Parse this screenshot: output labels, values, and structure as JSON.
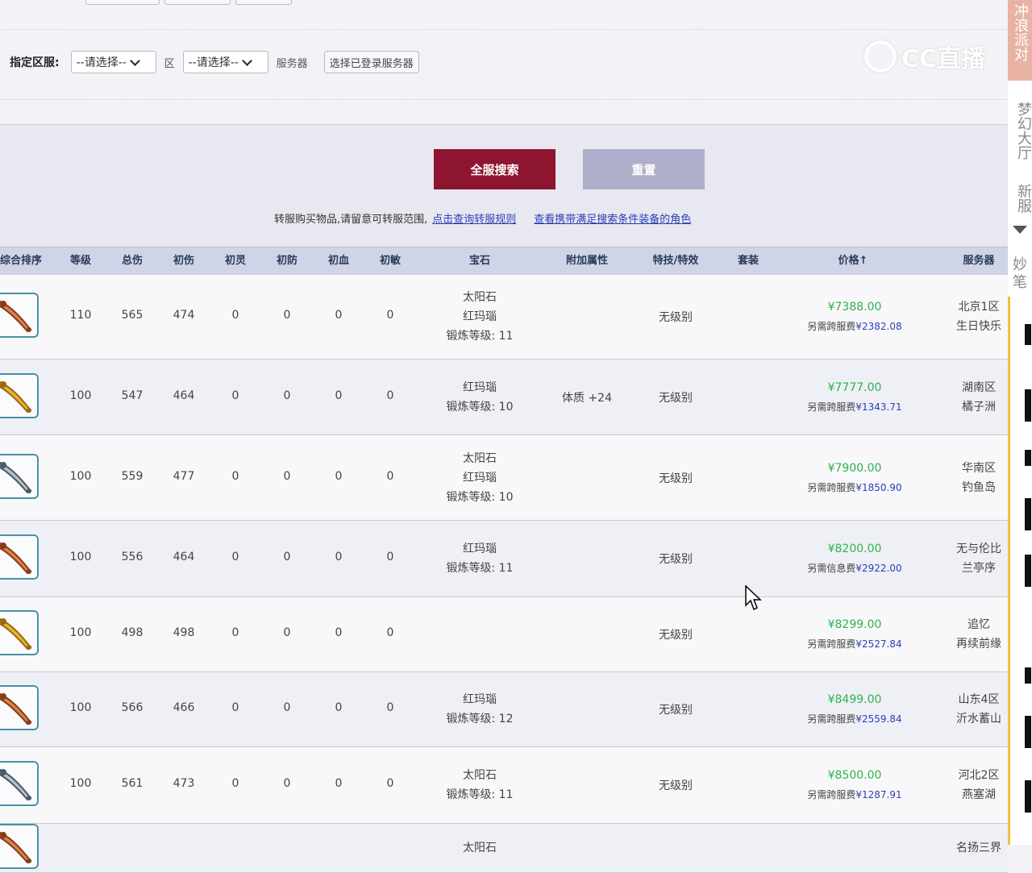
{
  "filter": {
    "label": "指定区服:",
    "region_select": "--请选择--",
    "region_suffix": "区",
    "server_select": "--请选择--",
    "server_suffix": "服务器",
    "logged_server_button": "选择已登录服务器"
  },
  "actions": {
    "search_all": "全服搜索",
    "reset": "重置"
  },
  "notice": {
    "text": "转服购买物品,请留意可转服范围,",
    "link1": "点击查询转服规则",
    "link2": "查看携带满足搜索条件装备的角色"
  },
  "table": {
    "headers": [
      "综合排序",
      "等级",
      "总伤",
      "初伤",
      "初灵",
      "初防",
      "初血",
      "初敏",
      "宝石",
      "附加属性",
      "特技/特效",
      "套装",
      "价格↑",
      "服务器"
    ],
    "rows": [
      {
        "level": "110",
        "total": "565",
        "init_dmg": "474",
        "init_ling": "0",
        "init_def": "0",
        "init_hp": "0",
        "init_agi": "0",
        "gems": [
          "太阳石",
          "红玛瑙",
          "锻炼等级: 11"
        ],
        "extra": "",
        "skill": "无级别",
        "suit": "",
        "price": "¥7388.00",
        "fee_label": "另需跨服费",
        "fee": "¥2382.08",
        "server": [
          "北京1区",
          "生日快乐"
        ],
        "thumb": "blade-red"
      },
      {
        "level": "100",
        "total": "547",
        "init_dmg": "464",
        "init_ling": "0",
        "init_def": "0",
        "init_hp": "0",
        "init_agi": "0",
        "gems": [
          "红玛瑙",
          "锻炼等级: 10"
        ],
        "extra": "体质 +24",
        "skill": "无级别",
        "suit": "",
        "price": "¥7777.00",
        "fee_label": "另需跨服费",
        "fee": "¥1343.71",
        "server": [
          "湖南区",
          "橘子洲"
        ],
        "thumb": "blade-gold"
      },
      {
        "level": "100",
        "total": "559",
        "init_dmg": "477",
        "init_ling": "0",
        "init_def": "0",
        "init_hp": "0",
        "init_agi": "0",
        "gems": [
          "太阳石",
          "红玛瑙",
          "锻炼等级: 10"
        ],
        "extra": "",
        "skill": "无级别",
        "suit": "",
        "price": "¥7900.00",
        "fee_label": "另需跨服费",
        "fee": "¥1850.90",
        "server": [
          "华南区",
          "钓鱼岛"
        ],
        "thumb": "blade-silver"
      },
      {
        "level": "100",
        "total": "556",
        "init_dmg": "464",
        "init_ling": "0",
        "init_def": "0",
        "init_hp": "0",
        "init_agi": "0",
        "gems": [
          "红玛瑙",
          "锻炼等级: 11"
        ],
        "extra": "",
        "skill": "无级别",
        "suit": "",
        "price": "¥8200.00",
        "fee_label": "另需信息费",
        "fee": "¥2922.00",
        "server": [
          "无与伦比",
          "兰亭序"
        ],
        "thumb": "blade-red"
      },
      {
        "level": "100",
        "total": "498",
        "init_dmg": "498",
        "init_ling": "0",
        "init_def": "0",
        "init_hp": "0",
        "init_agi": "0",
        "gems": [],
        "extra": "",
        "skill": "无级别",
        "suit": "",
        "price": "¥8299.00",
        "fee_label": "另需跨服费",
        "fee": "¥2527.84",
        "server": [
          "追忆",
          "再续前缘"
        ],
        "thumb": "blade-gold"
      },
      {
        "level": "100",
        "total": "566",
        "init_dmg": "466",
        "init_ling": "0",
        "init_def": "0",
        "init_hp": "0",
        "init_agi": "0",
        "gems": [
          "红玛瑙",
          "锻炼等级: 12"
        ],
        "extra": "",
        "skill": "无级别",
        "suit": "",
        "price": "¥8499.00",
        "fee_label": "另需跨服费",
        "fee": "¥2559.84",
        "server": [
          "山东4区",
          "沂水蓄山"
        ],
        "thumb": "blade-red"
      },
      {
        "level": "100",
        "total": "561",
        "init_dmg": "473",
        "init_ling": "0",
        "init_def": "0",
        "init_hp": "0",
        "init_agi": "0",
        "gems": [
          "太阳石",
          "锻炼等级: 11"
        ],
        "extra": "",
        "skill": "无级别",
        "suit": "",
        "price": "¥8500.00",
        "fee_label": "另需跨服费",
        "fee": "¥1287.91",
        "server": [
          "河北2区",
          "燕塞湖"
        ],
        "thumb": "blade-silver"
      },
      {
        "level": "",
        "total": "",
        "init_dmg": "",
        "init_ling": "",
        "init_def": "",
        "init_hp": "",
        "init_agi": "",
        "gems": [
          "太阳石"
        ],
        "extra": "",
        "skill": "",
        "suit": "",
        "price": "",
        "fee_label": "",
        "fee": "",
        "server": [
          "名扬三界"
        ],
        "thumb": "blade-red"
      }
    ]
  },
  "sidebar": {
    "top_label": "冲浪派对",
    "item1": "梦幻大厅",
    "item2": "新服",
    "item3": "妙笔"
  },
  "watermark": "CC直播",
  "colors": {
    "search_button": "#8e1530",
    "reset_button": "#aeaecb",
    "price_green": "#2db34a",
    "link_blue": "#2b3fb5",
    "header_bg": "#cfd5e6"
  }
}
